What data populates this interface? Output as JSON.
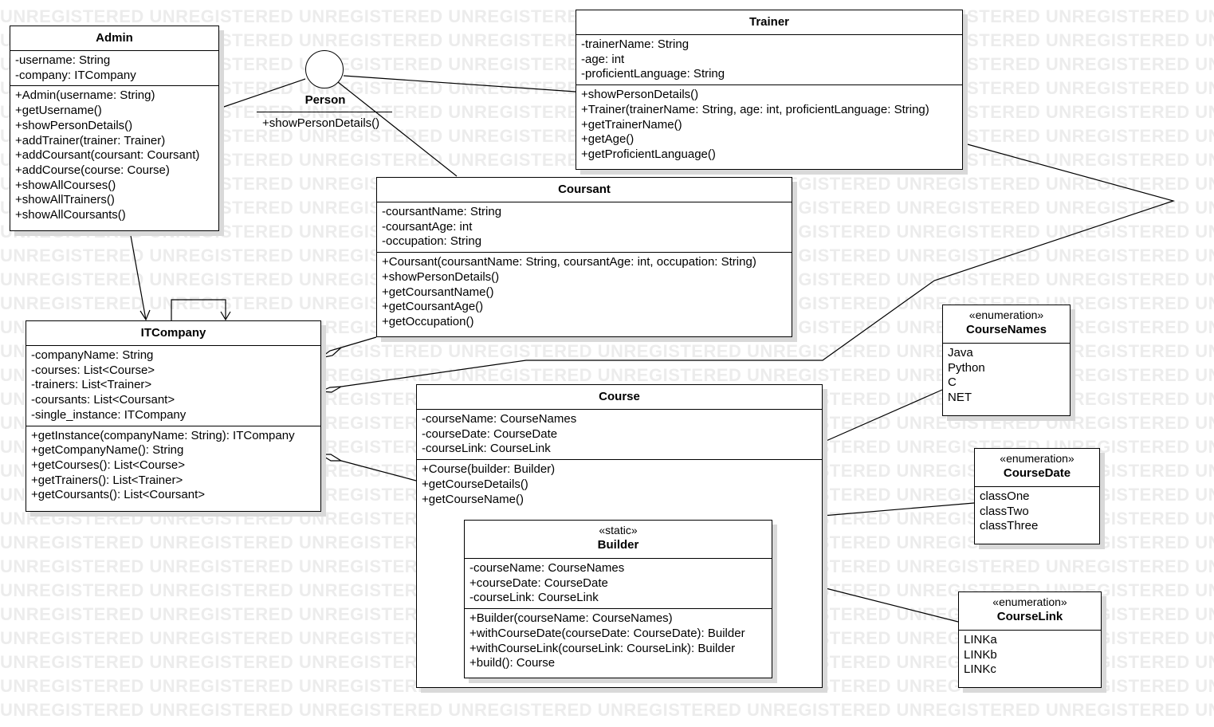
{
  "watermark": {
    "text": "UNREGISTERED"
  },
  "person": {
    "name": "Person",
    "operations": [
      "+showPersonDetails()"
    ]
  },
  "admin": {
    "name": "Admin",
    "attributes": [
      "-username: String",
      "-company: ITCompany"
    ],
    "operations": [
      "+Admin(username: String)",
      "+getUsername()",
      "+showPersonDetails()",
      "+addTrainer(trainer: Trainer)",
      "+addCoursant(coursant: Coursant)",
      "+addCourse(course: Course)",
      "+showAllCourses()",
      "+showAllTrainers()",
      "+showAllCoursants()"
    ]
  },
  "trainer": {
    "name": "Trainer",
    "attributes": [
      "-trainerName: String",
      "-age: int",
      "-proficientLanguage: String"
    ],
    "operations": [
      "+showPersonDetails()",
      "+Trainer(trainerName: String, age: int, proficientLanguage: String)",
      "+getTrainerName()",
      "+getAge()",
      "+getProficientLanguage()"
    ]
  },
  "coursant": {
    "name": "Coursant",
    "attributes": [
      "-coursantName: String",
      "-coursantAge: int",
      "-occupation: String"
    ],
    "operations": [
      "+Coursant(coursantName: String, coursantAge: int, occupation: String)",
      "+showPersonDetails()",
      "+getCoursantName()",
      "+getCoursantAge()",
      "+getOccupation()"
    ]
  },
  "itcompany": {
    "name": "ITCompany",
    "attributes": [
      "-companyName: String",
      "-courses: List<Course>",
      "-trainers: List<Trainer>",
      "-coursants: List<Coursant>",
      "-single_instance: ITCompany"
    ],
    "operations": [
      "+getInstance(companyName: String): ITCompany",
      "+getCompanyName(): String",
      "+getCourses(): List<Course>",
      "+getTrainers(): List<Trainer>",
      "+getCoursants(): List<Coursant>"
    ]
  },
  "course": {
    "name": "Course",
    "attributes": [
      "-courseName: CourseNames",
      "-courseDate: CourseDate",
      "-courseLink: CourseLink"
    ],
    "operations": [
      "+Course(builder: Builder)",
      "+getCourseDetails()",
      "+getCourseName()"
    ]
  },
  "builder": {
    "stereotype": "«static»",
    "name": "Builder",
    "attributes": [
      "-courseName: CourseNames",
      "+courseDate: CourseDate",
      "-courseLink: CourseLink"
    ],
    "operations": [
      "+Builder(courseName: CourseNames)",
      "+withCourseDate(courseDate: CourseDate): Builder",
      "+withCourseLink(courseLink: CourseLink): Builder",
      "+build(): Course"
    ]
  },
  "course_names": {
    "stereotype": "«enumeration»",
    "name": "CourseNames",
    "literals": [
      "Java",
      "Python",
      "C",
      "NET"
    ]
  },
  "course_date": {
    "stereotype": "«enumeration»",
    "name": "CourseDate",
    "literals": [
      "classOne",
      "classTwo",
      "classThree"
    ]
  },
  "course_link": {
    "stereotype": "«enumeration»",
    "name": "CourseLink",
    "literals": [
      "LINKa",
      "LINKb",
      "LINKc"
    ]
  }
}
